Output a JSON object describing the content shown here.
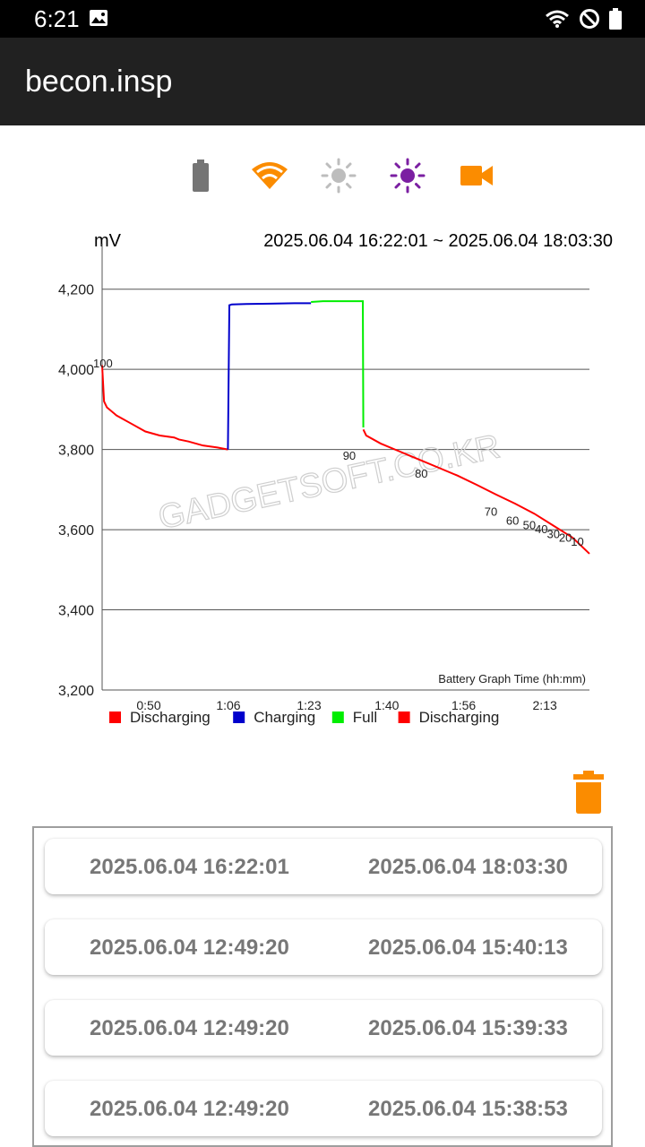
{
  "status_bar": {
    "time": "6:21"
  },
  "app_bar": {
    "title": "becon.insp"
  },
  "toolbar_icons": [
    {
      "icon": "battery-icon",
      "color": "#757575"
    },
    {
      "icon": "wifi-icon",
      "color": "#fb8c00"
    },
    {
      "icon": "brightness-icon",
      "color": "#bdbdbd"
    },
    {
      "icon": "brightness-icon",
      "color": "#7b1fa2"
    },
    {
      "icon": "video-camera-icon",
      "color": "#fb8c00"
    }
  ],
  "chart_data": {
    "type": "line",
    "unit_label": "mV",
    "range_label": "2025.06.04 16:22:01 ~ 2025.06.04 18:03:30",
    "xlabel": "Battery Graph Time (hh:mm)",
    "ylim": [
      3200,
      4300
    ],
    "xlim": [
      0,
      101.5
    ],
    "y_ticks": [
      3200,
      3400,
      3600,
      3800,
      4000,
      4200
    ],
    "y_tick_labels": [
      "3,200",
      "3,400",
      "3,600",
      "3,800",
      "4,000",
      "4,200"
    ],
    "x_ticks": [
      9.7,
      26.3,
      43.1,
      59.3,
      75.3,
      92.2
    ],
    "x_tick_labels": [
      "0:50",
      "1:06",
      "1:23",
      "1:40",
      "1:56",
      "2:13"
    ],
    "grid": true,
    "watermark": "GADGETSOFT.CO.KR",
    "legend": [
      {
        "name": "Discharging",
        "color": "#ff0000"
      },
      {
        "name": "Charging",
        "color": "#0000cc"
      },
      {
        "name": "Full",
        "color": "#00ee00"
      },
      {
        "name": "Discharging",
        "color": "#ff0000"
      }
    ],
    "series": [
      {
        "name": "Discharging",
        "color": "#ff0000",
        "x": [
          0,
          0.4,
          1,
          3,
          6,
          9,
          12,
          15,
          16,
          18,
          21,
          24,
          26.2
        ],
        "y": [
          4010,
          3920,
          3905,
          3885,
          3865,
          3845,
          3835,
          3830,
          3825,
          3820,
          3810,
          3805,
          3800
        ]
      },
      {
        "name": "Charging",
        "color": "#0000cc",
        "x": [
          26.2,
          26.5,
          27,
          30,
          35,
          40,
          43.5
        ],
        "y": [
          3800,
          4160,
          4162,
          4163,
          4164,
          4165,
          4165
        ]
      },
      {
        "name": "Full",
        "color": "#00ee00",
        "x": [
          43.5,
          46,
          50,
          53,
          54.3,
          54.4
        ],
        "y": [
          4168,
          4170,
          4170,
          4170,
          4170,
          3855
        ]
      },
      {
        "name": "Discharging",
        "color": "#ff0000",
        "x": [
          54.4,
          55,
          58,
          62,
          66,
          70,
          74,
          78,
          82,
          86,
          90,
          94,
          98,
          101.5
        ],
        "y": [
          3850,
          3835,
          3815,
          3795,
          3775,
          3755,
          3735,
          3712,
          3688,
          3665,
          3640,
          3610,
          3580,
          3540
        ]
      }
    ],
    "annotations": [
      {
        "x": 0,
        "y": 4000,
        "label": "100"
      },
      {
        "x": 52,
        "y": 3770,
        "label": "90"
      },
      {
        "x": 67,
        "y": 3725,
        "label": "80"
      },
      {
        "x": 81.5,
        "y": 3630,
        "label": "70"
      },
      {
        "x": 86,
        "y": 3608,
        "label": "60"
      },
      {
        "x": 89.5,
        "y": 3597,
        "label": "50"
      },
      {
        "x": 92,
        "y": 3587,
        "label": "40"
      },
      {
        "x": 94.5,
        "y": 3575,
        "label": "30"
      },
      {
        "x": 97,
        "y": 3565,
        "label": "20"
      },
      {
        "x": 99.5,
        "y": 3555,
        "label": "10"
      }
    ]
  },
  "sessions": [
    {
      "start": "2025.06.04 16:22:01",
      "end": "2025.06.04 18:03:30"
    },
    {
      "start": "2025.06.04 12:49:20",
      "end": "2025.06.04 15:40:13"
    },
    {
      "start": "2025.06.04 12:49:20",
      "end": "2025.06.04 15:39:33"
    },
    {
      "start": "2025.06.04 12:49:20",
      "end": "2025.06.04 15:38:53"
    }
  ]
}
